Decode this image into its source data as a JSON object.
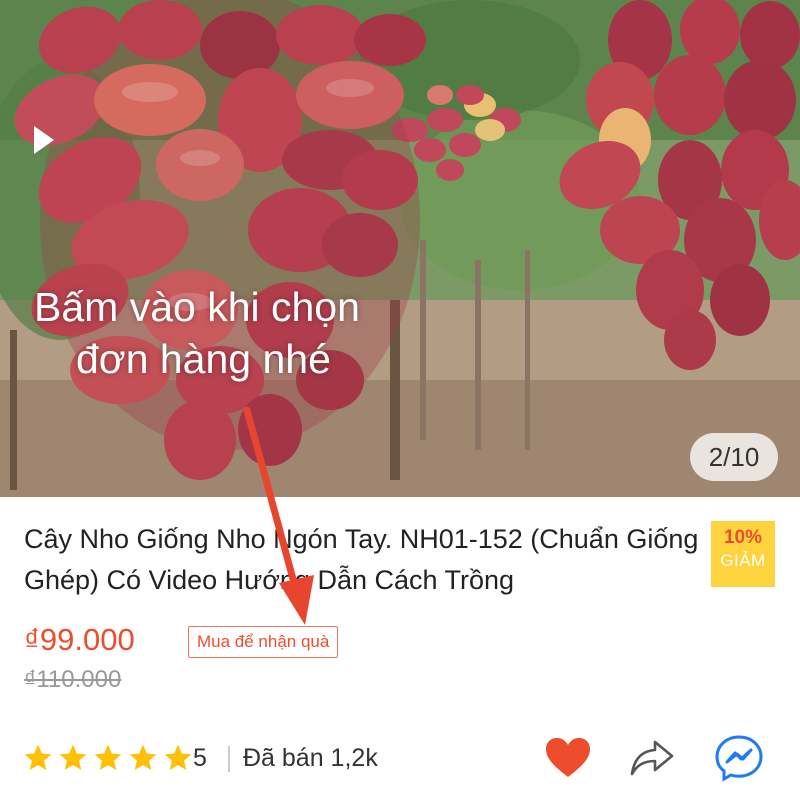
{
  "hero": {
    "overlay_line1": "Bấm vào khi chọn",
    "overlay_line2": "đơn hàng nhé",
    "counter": "2/10",
    "play_icon": "play-icon"
  },
  "product": {
    "title": "Cây Nho Giống Nho Ngón Tay. NH01-152 (Chuẩn Giống Ghép) Có Video Hướng Dẫn Cách Trồng",
    "discount_pct": "10%",
    "discount_label": "GIẢM",
    "price": "₫99.000",
    "original_price": "₫110.000",
    "gift_tag": "Mua để nhận quà"
  },
  "rating": {
    "score": "5",
    "stars": 5,
    "sold": "Đã bán 1,2k"
  },
  "actions": {
    "like_icon": "heart-icon",
    "share_icon": "share-icon",
    "messenger_icon": "messenger-icon"
  },
  "colors": {
    "accent": "#ee4d2d",
    "badge_bg": "#ffd33d",
    "arrow": "#e8452f",
    "star": "#ffc107",
    "messenger": "#1f7af5"
  }
}
